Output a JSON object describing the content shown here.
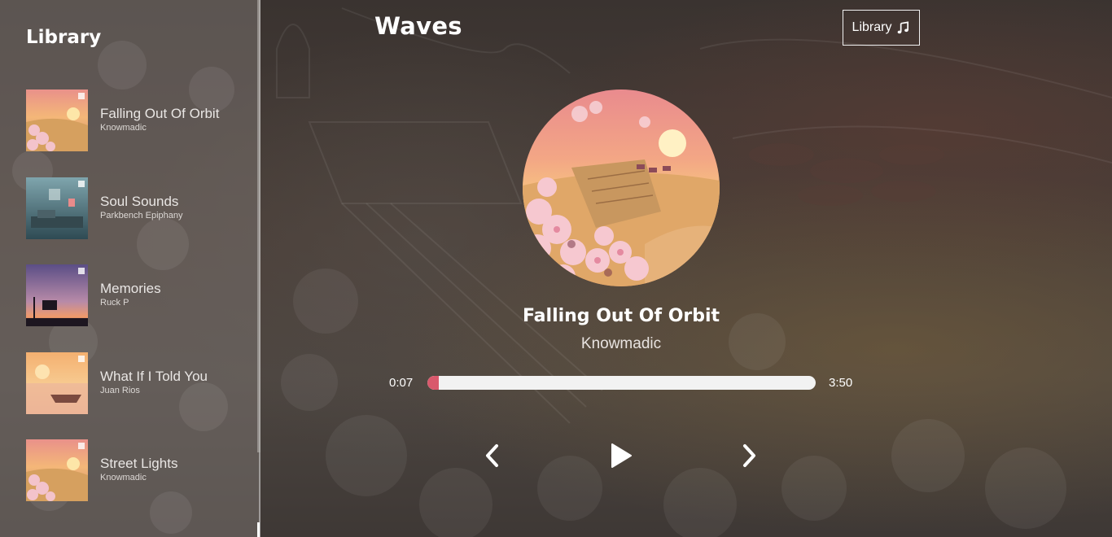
{
  "app": {
    "title": "Waves"
  },
  "header": {
    "library_button_label": "Library",
    "library_button_icon": "music-note-icon"
  },
  "sidebar": {
    "title": "Library",
    "songs": [
      {
        "name": "Falling Out Of Orbit",
        "artist": "Knowmadic",
        "cover": "sunset-blossoms"
      },
      {
        "name": "Soul Sounds",
        "artist": "Parkbench Epiphany",
        "cover": "teal-room"
      },
      {
        "name": "Memories",
        "artist": "Ruck P",
        "cover": "purple-dusk"
      },
      {
        "name": "What If I Told You",
        "artist": "Juan Rios",
        "cover": "boat-sunset"
      },
      {
        "name": "Street Lights",
        "artist": "Knowmadic",
        "cover": "sunset-blossoms"
      }
    ]
  },
  "player": {
    "track_title": "Falling Out Of Orbit",
    "track_artist": "Knowmadic",
    "current_time": "0:07",
    "total_time": "3:50",
    "progress_fraction": 0.03,
    "controls": {
      "prev_icon": "chevron-left-icon",
      "play_icon": "play-icon",
      "next_icon": "chevron-right-icon"
    }
  },
  "colors": {
    "accent": "#d9596c",
    "track_background": "#f2f2f2",
    "sidebar_background": "#7a7370"
  }
}
